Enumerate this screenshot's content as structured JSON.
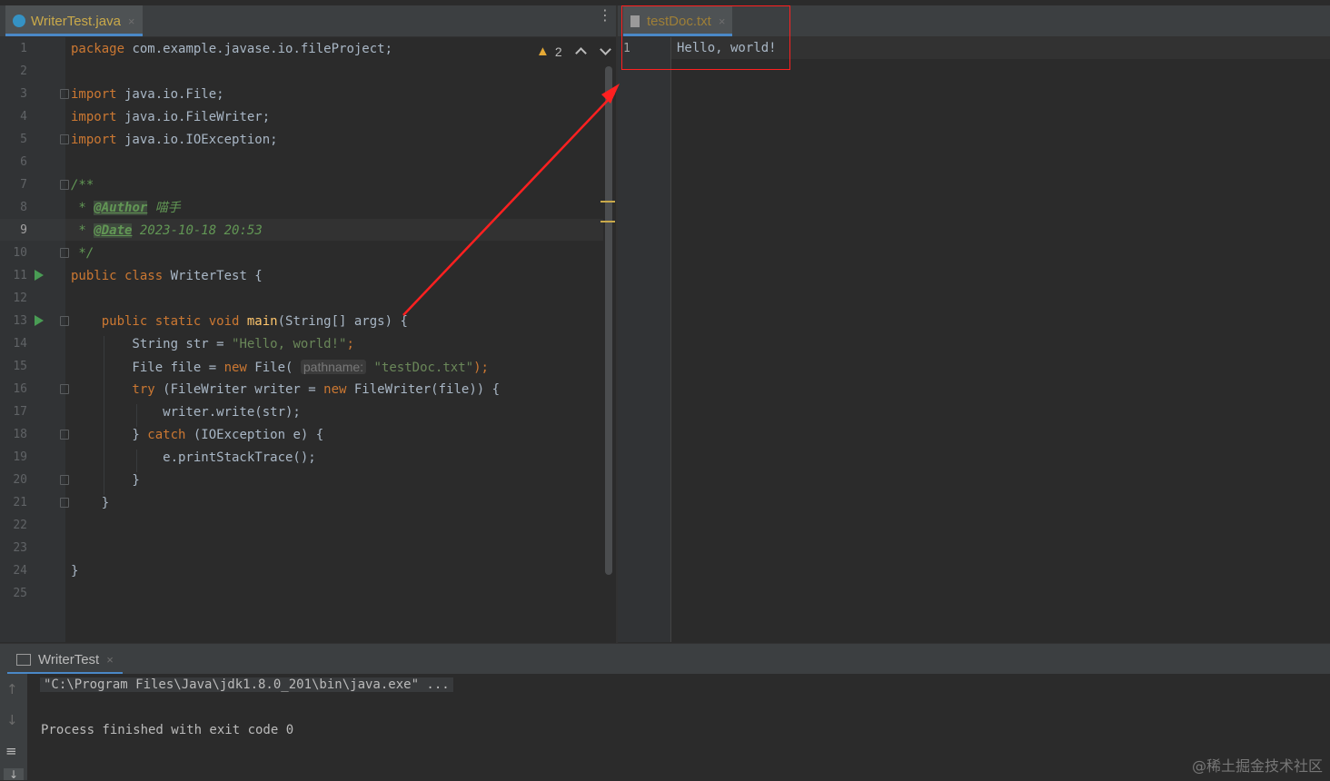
{
  "left_tab": {
    "label": "WriterTest.java",
    "close": "×"
  },
  "right_tab": {
    "label": "testDoc.txt",
    "close": "×"
  },
  "inspections": {
    "warning_count": "2",
    "prev": "^",
    "next": "v"
  },
  "left_line_numbers": [
    "1",
    "2",
    "3",
    "4",
    "5",
    "6",
    "7",
    "8",
    "9",
    "10",
    "11",
    "12",
    "13",
    "14",
    "15",
    "16",
    "17",
    "18",
    "19",
    "20",
    "21",
    "22",
    "23",
    "24",
    "25"
  ],
  "code": {
    "l1_kw": "package",
    "l1_rest": " com.example.javase.io.fileProject;",
    "l3_kw": "import",
    "l3_rest": " java.io.File;",
    "l4_kw": "import",
    "l4_rest": " java.io.FileWriter;",
    "l5_kw": "import",
    "l5_rest": " java.io.IOException;",
    "l7": "/**",
    "l8_star": " * ",
    "l8_tag": "@Author",
    "l8_val": " 喵手",
    "l9_star": " * ",
    "l9_tag": "@Date",
    "l9_val": " 2023-10-18 20:53",
    "l10": " */",
    "l11_kw": "public class",
    "l11_rest": " WriterTest {",
    "l13_kw": "    public static void",
    "l13_fn": " main",
    "l13_rest": "(String[] args) {",
    "l14_a": "        String str = ",
    "l14_str": "\"Hello, world!\"",
    "l14_b": ";",
    "l15_a": "        File file = ",
    "l15_kw": "new",
    "l15_b": " File( ",
    "l15_hint": "pathname:",
    "l15_str": " \"testDoc.txt\"",
    "l15_c": ");",
    "l16_kw": "        try",
    "l16_a": " (FileWriter writer = ",
    "l16_kw2": "new",
    "l16_b": " FileWriter(file)) {",
    "l17": "            writer.write(str);",
    "l18_a": "        } ",
    "l18_kw": "catch",
    "l18_b": " (IOException e) {",
    "l19": "            e.printStackTrace();",
    "l20": "        }",
    "l21": "    }",
    "l24": "}"
  },
  "right_editor": {
    "line_number": "1",
    "content": "Hello, world!"
  },
  "run_tab": {
    "label": "WriterTest",
    "close": "×"
  },
  "console": {
    "command": "\"C:\\Program Files\\Java\\jdk1.8.0_201\\bin\\java.exe\" ...",
    "result": "Process finished with exit code 0"
  },
  "watermark": "@稀土掘金技术社区",
  "colors": {
    "annotation_red": "#ff2020",
    "run_green": "#499c54",
    "accent_blue": "#4a88c7"
  }
}
